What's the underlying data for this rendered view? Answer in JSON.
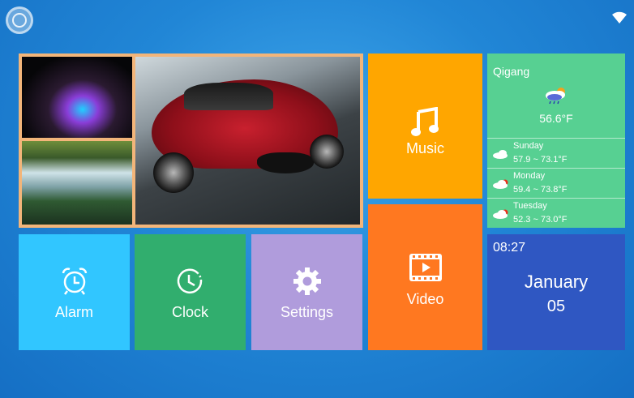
{
  "status_bar": {
    "home_icon": "home-circle-icon",
    "wifi_icon": "wifi-icon"
  },
  "gallery": {
    "photos": [
      "water-splash-photo",
      "waterfall-photo",
      "red-sports-car-photo"
    ]
  },
  "tiles": {
    "music": {
      "label": "Music",
      "icon": "music-note-icon",
      "color": "#ffa600"
    },
    "video": {
      "label": "Video",
      "icon": "film-play-icon",
      "color": "#ff7820"
    },
    "alarm": {
      "label": "Alarm",
      "icon": "alarm-clock-icon",
      "color": "#31c6ff"
    },
    "clock": {
      "label": "Clock",
      "icon": "clock-history-icon",
      "color": "#31ae6e"
    },
    "settings": {
      "label": "Settings",
      "icon": "gear-icon",
      "color": "#b09cdc"
    }
  },
  "weather": {
    "city": "Qigang",
    "current_temp": "56.6°F",
    "forecast": [
      {
        "day": "Sunday",
        "range": "57.9 ~ 73.1°F"
      },
      {
        "day": "Monday",
        "range": "59.4 ~ 73.8°F"
      },
      {
        "day": "Tuesday",
        "range": "52.3 ~ 73.0°F"
      }
    ]
  },
  "datetime": {
    "time": "08:27",
    "month": "January",
    "day": "05"
  }
}
